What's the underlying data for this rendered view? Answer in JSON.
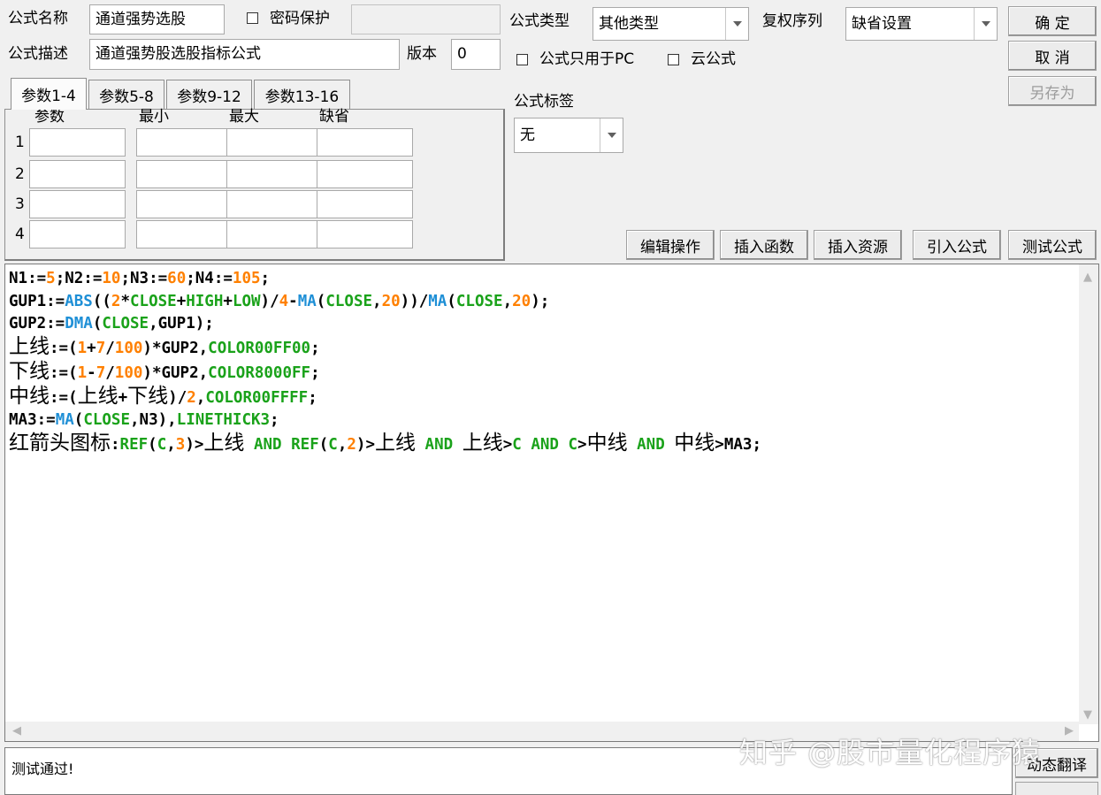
{
  "header": {
    "name_label": "公式名称",
    "name_value": "通道强势选股",
    "password_label": "密码保护",
    "password_value": "",
    "desc_label": "公式描述",
    "desc_value": "通道强势股选股指标公式",
    "version_label": "版本",
    "version_value": "0",
    "type_label": "公式类型",
    "type_value": "其他类型",
    "rights_label": "复权序列",
    "rights_value": "缺省设置",
    "pc_only_label": "公式只用于PC",
    "cloud_label": "云公式",
    "tag_label": "公式标签",
    "tag_value": "无"
  },
  "buttons": {
    "ok": "确 定",
    "cancel": "取 消",
    "save_as": "另存为",
    "edit_ops": "编辑操作",
    "insert_func": "插入函数",
    "insert_resource": "插入资源",
    "import_formula": "引入公式",
    "test_formula": "测试公式",
    "dynamic_translate": "动态翻译"
  },
  "params": {
    "tabs": [
      "参数1-4",
      "参数5-8",
      "参数9-12",
      "参数13-16"
    ],
    "active_tab": 0,
    "columns": [
      "参数",
      "最小",
      "最大",
      "缺省"
    ],
    "rows": [
      "1",
      "2",
      "3",
      "4"
    ]
  },
  "code_lines": [
    [
      [
        "v",
        "N1:="
      ],
      [
        "n",
        "5"
      ],
      [
        "v",
        ";N2:="
      ],
      [
        "n",
        "10"
      ],
      [
        "v",
        ";N3:="
      ],
      [
        "n",
        "60"
      ],
      [
        "v",
        ";N4:="
      ],
      [
        "n",
        "105"
      ],
      [
        "v",
        ";"
      ]
    ],
    [
      [
        "v",
        "GUP1:="
      ],
      [
        "f",
        "ABS"
      ],
      [
        "v",
        "(("
      ],
      [
        "n",
        "2"
      ],
      [
        "v",
        "*"
      ],
      [
        "g",
        "CLOSE"
      ],
      [
        "v",
        "+"
      ],
      [
        "g",
        "HIGH"
      ],
      [
        "v",
        "+"
      ],
      [
        "g",
        "LOW"
      ],
      [
        "v",
        ")/"
      ],
      [
        "n",
        "4"
      ],
      [
        "v",
        "-"
      ],
      [
        "f",
        "MA"
      ],
      [
        "v",
        "("
      ],
      [
        "g",
        "CLOSE"
      ],
      [
        "v",
        ","
      ],
      [
        "n",
        "20"
      ],
      [
        "v",
        "))/"
      ],
      [
        "f",
        "MA"
      ],
      [
        "v",
        "("
      ],
      [
        "g",
        "CLOSE"
      ],
      [
        "v",
        ","
      ],
      [
        "n",
        "20"
      ],
      [
        "v",
        ");"
      ]
    ],
    [
      [
        "v",
        "GUP2:="
      ],
      [
        "f",
        "DMA"
      ],
      [
        "v",
        "("
      ],
      [
        "g",
        "CLOSE"
      ],
      [
        "v",
        ",GUP1);"
      ]
    ],
    [
      [
        "c",
        "上线"
      ],
      [
        "v",
        ":=("
      ],
      [
        "n",
        "1"
      ],
      [
        "v",
        "+"
      ],
      [
        "n",
        "7"
      ],
      [
        "v",
        "/"
      ],
      [
        "n",
        "100"
      ],
      [
        "v",
        ")*GUP2,"
      ],
      [
        "g",
        "COLOR00FF00"
      ],
      [
        "v",
        ";"
      ]
    ],
    [
      [
        "c",
        "下线"
      ],
      [
        "v",
        ":=("
      ],
      [
        "n",
        "1"
      ],
      [
        "v",
        "-"
      ],
      [
        "n",
        "7"
      ],
      [
        "v",
        "/"
      ],
      [
        "n",
        "100"
      ],
      [
        "v",
        ")*GUP2,"
      ],
      [
        "g",
        "COLOR8000FF"
      ],
      [
        "v",
        ";"
      ]
    ],
    [
      [
        "c",
        "中线"
      ],
      [
        "v",
        ":=("
      ],
      [
        "c",
        "上线"
      ],
      [
        "v",
        "+"
      ],
      [
        "c",
        "下线"
      ],
      [
        "v",
        ")/"
      ],
      [
        "n",
        "2"
      ],
      [
        "v",
        ","
      ],
      [
        "g",
        "COLOR00FFFF"
      ],
      [
        "v",
        ";"
      ]
    ],
    [
      [
        "v",
        "MA3:="
      ],
      [
        "f",
        "MA"
      ],
      [
        "v",
        "("
      ],
      [
        "g",
        "CLOSE"
      ],
      [
        "v",
        ",N3),"
      ],
      [
        "g",
        "LINETHICK3"
      ],
      [
        "v",
        ";"
      ]
    ],
    [
      [
        "c",
        "红箭头图标"
      ],
      [
        "v",
        ":"
      ],
      [
        "g",
        "REF"
      ],
      [
        "v",
        "("
      ],
      [
        "g",
        "C"
      ],
      [
        "v",
        ","
      ],
      [
        "n",
        "3"
      ],
      [
        "v",
        ")>"
      ],
      [
        "c",
        "上线"
      ],
      [
        "v",
        " "
      ],
      [
        "g",
        "AND"
      ],
      [
        "v",
        " "
      ],
      [
        "g",
        "REF"
      ],
      [
        "v",
        "("
      ],
      [
        "g",
        "C"
      ],
      [
        "v",
        ","
      ],
      [
        "n",
        "2"
      ],
      [
        "v",
        ")>"
      ],
      [
        "c",
        "上线"
      ],
      [
        "v",
        " "
      ],
      [
        "g",
        "AND"
      ],
      [
        "v",
        " "
      ],
      [
        "c",
        "上线"
      ],
      [
        "v",
        ">"
      ],
      [
        "g",
        "C"
      ],
      [
        "v",
        " "
      ],
      [
        "g",
        "AND"
      ],
      [
        "v",
        " "
      ],
      [
        "g",
        "C"
      ],
      [
        "v",
        ">"
      ],
      [
        "c",
        "中线"
      ],
      [
        "v",
        " "
      ],
      [
        "g",
        "AND"
      ],
      [
        "v",
        " "
      ],
      [
        "c",
        "中线"
      ],
      [
        "v",
        ">MA3;"
      ]
    ]
  ],
  "status": {
    "message": "测试通过!"
  },
  "watermark": "知乎 @股市量化程序猿",
  "colors": {
    "number": "#ff8000",
    "function": "#1e8fd6",
    "variable": "#1aa21a",
    "plain": "#000000"
  }
}
